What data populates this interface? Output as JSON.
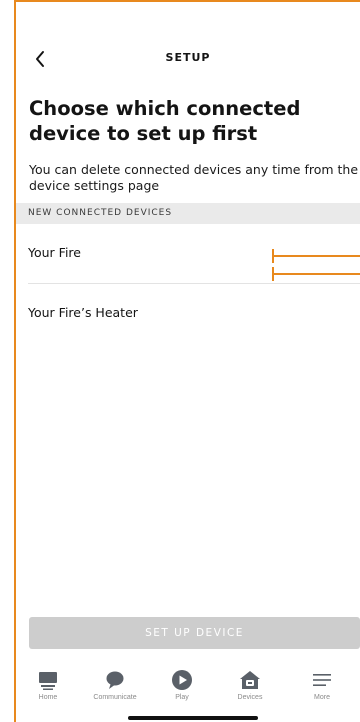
{
  "header": {
    "back_icon": "chevron-left-icon",
    "title": "SETUP"
  },
  "main": {
    "headline": "Choose which connected device to set up first",
    "subtitle": "You can delete connected devices any time from the device settings page",
    "section_label": "NEW CONNECTED DEVICES",
    "devices": [
      {
        "label": "Your Fire"
      },
      {
        "label": "Your Fire’s Heater"
      }
    ],
    "setup_button": "SET UP DEVICE"
  },
  "tabs": [
    {
      "label": "Home",
      "icon": "home-icon"
    },
    {
      "label": "Communicate",
      "icon": "chat-icon"
    },
    {
      "label": "Play",
      "icon": "play-icon"
    },
    {
      "label": "Devices",
      "icon": "devices-icon"
    },
    {
      "label": "More",
      "icon": "menu-icon"
    }
  ],
  "colors": {
    "accent": "#e8891e",
    "button_disabled": "#cdcdcd",
    "section_bg": "#eaeaea",
    "icon": "#5a6068"
  }
}
